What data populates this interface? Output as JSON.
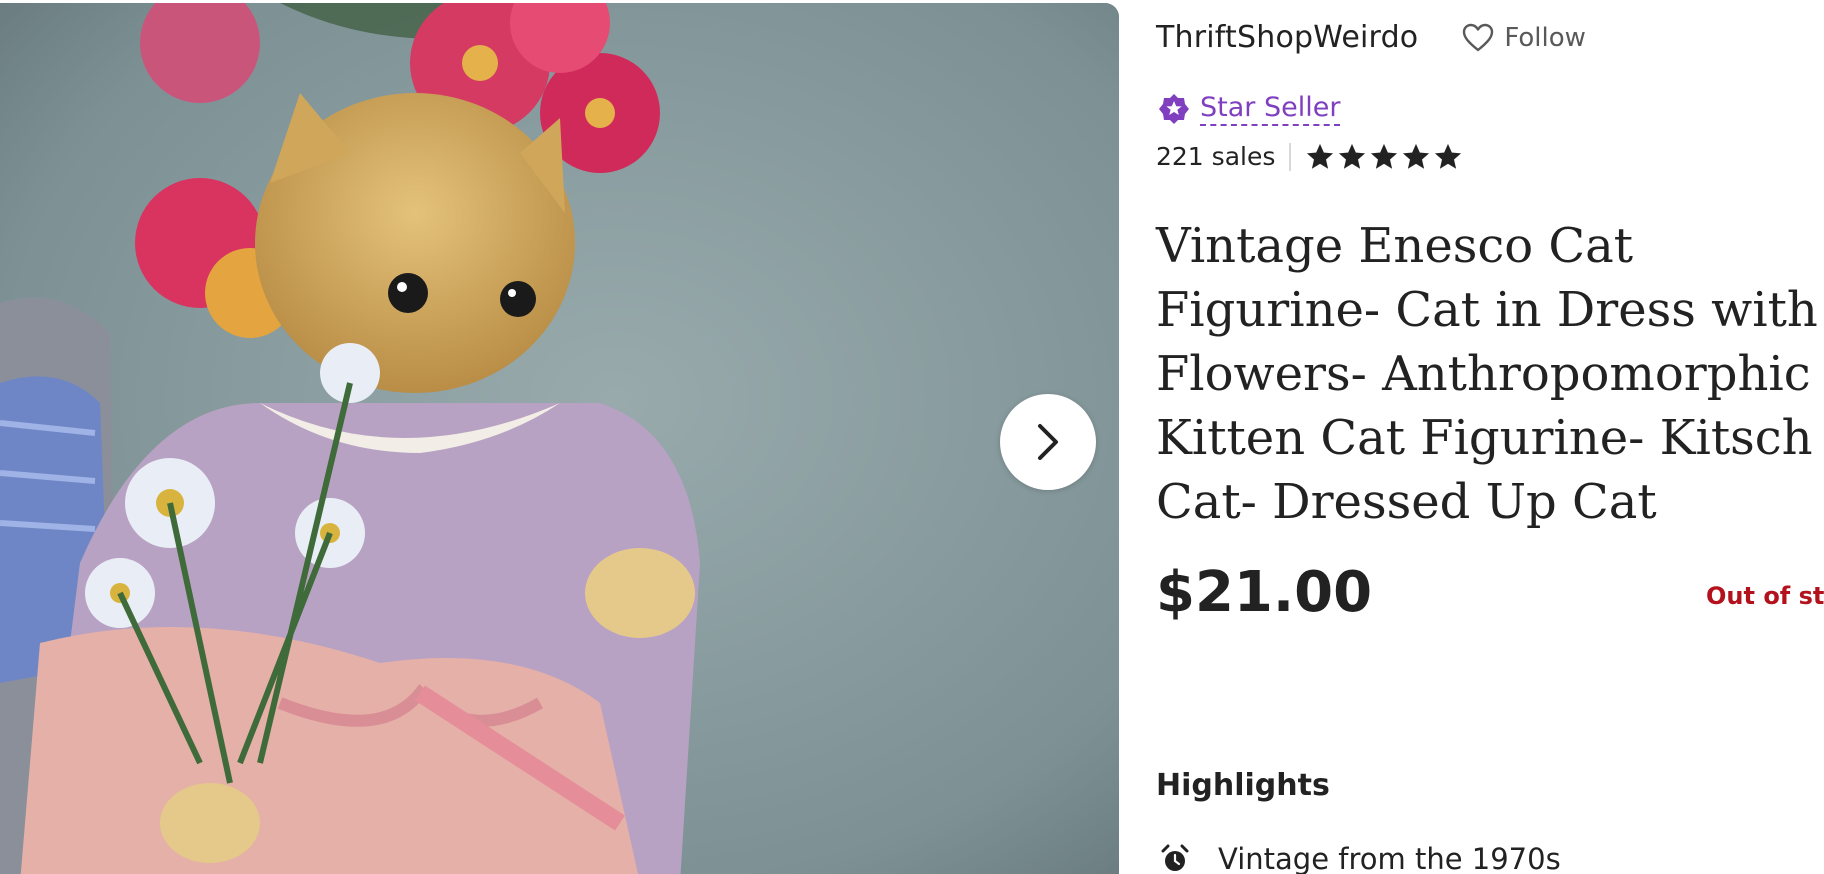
{
  "shop": {
    "name": "ThriftShopWeirdo",
    "follow_label": "Follow",
    "badge_label": "Star Seller",
    "sales": "221 sales",
    "rating": 5,
    "rating_max": 5
  },
  "listing": {
    "title": "Vintage Enesco Cat Figurine- Cat in Dress with Flowers- Anthropomorphic Kitten Cat Figurine- Kitsch Cat- Dressed Up Cat",
    "price": "$21.00",
    "stock_status": "Out of sto"
  },
  "highlights": {
    "heading": "Highlights",
    "items": [
      {
        "icon": "alarm-clock-icon",
        "text": "Vintage from the 1970s"
      }
    ]
  },
  "gallery": {
    "next_icon": "chevron-right-icon"
  },
  "colors": {
    "star_seller": "#7f3fbf",
    "out_of_stock": "#b3121c",
    "text": "#222222",
    "muted": "#595959"
  }
}
